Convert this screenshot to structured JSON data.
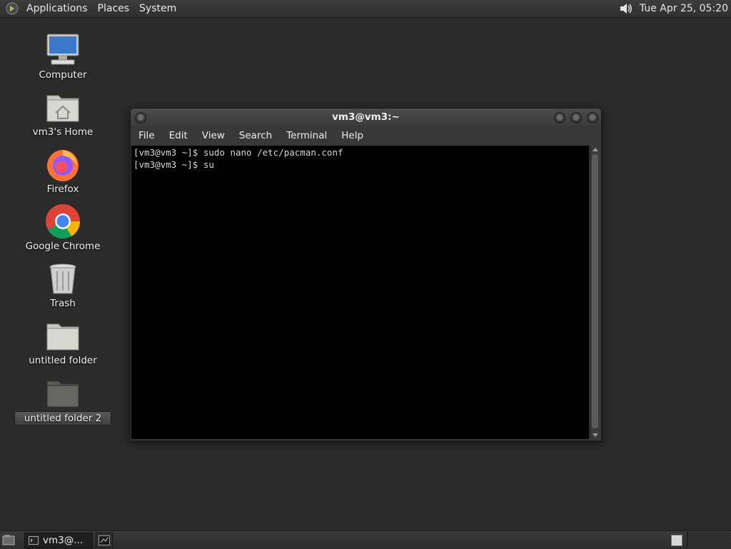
{
  "top_panel": {
    "menus": [
      "Applications",
      "Places",
      "System"
    ],
    "clock": "Tue Apr 25, 05:20",
    "icons": [
      "gnome-logo-icon",
      "volume-icon"
    ]
  },
  "desktop": {
    "icons": [
      {
        "label": "Computer",
        "icon": "computer-icon"
      },
      {
        "label": "vm3's Home",
        "icon": "home-folder-icon"
      },
      {
        "label": "Firefox",
        "icon": "firefox-icon"
      },
      {
        "label": "Google Chrome",
        "icon": "chrome-icon"
      },
      {
        "label": "Trash",
        "icon": "trash-icon"
      },
      {
        "label": "untitled folder",
        "icon": "folder-icon"
      },
      {
        "label": "untitled folder 2",
        "icon": "folder-icon",
        "selected": true
      }
    ]
  },
  "terminal": {
    "title": "vm3@vm3:~",
    "menu": [
      "File",
      "Edit",
      "View",
      "Search",
      "Terminal",
      "Help"
    ],
    "lines": [
      "[vm3@vm3 ~]$ sudo nano /etc/pacman.conf",
      "[vm3@vm3 ~]$ su"
    ]
  },
  "bottom_panel": {
    "task_label": "vm3@...",
    "icons": [
      "show-desktop-icon",
      "terminal-icon"
    ]
  },
  "colors": {
    "desktop_bg": "#2b2b29",
    "panel_bg": "#353533",
    "terminal_bg": "#000000",
    "terminal_fg": "#d6d6d6"
  }
}
